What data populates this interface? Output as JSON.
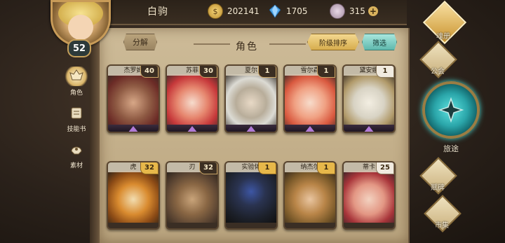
{
  "topbar": {
    "player_name": "白驹",
    "gold": "202141",
    "crystals": "1705",
    "stones": "315",
    "plus": "+"
  },
  "player": {
    "level": "52"
  },
  "left_tabs": [
    {
      "label": "角色",
      "icon": "hero-icon"
    },
    {
      "label": "技能书",
      "icon": "skillbook-icon"
    },
    {
      "label": "素材",
      "icon": "material-icon"
    }
  ],
  "header": {
    "split_label": "分解",
    "title": "角色",
    "sort_label": "阶级排序",
    "filter_label": "筛选"
  },
  "heroes": [
    {
      "name": "杰罗姆",
      "count": "40",
      "badge": "dark"
    },
    {
      "name": "苏菲",
      "count": "30",
      "badge": "dark"
    },
    {
      "name": "夏尔",
      "count": "1",
      "badge": "dark"
    },
    {
      "name": "雪尔森",
      "count": "1",
      "badge": "dark"
    },
    {
      "name": "黛安娜",
      "count": "1",
      "badge": "white"
    },
    {
      "name": "虎",
      "count": "32",
      "badge": "gold"
    },
    {
      "name": "刃",
      "count": "32",
      "badge": "dark"
    },
    {
      "name": "实验体",
      "count": "1",
      "badge": "gold"
    },
    {
      "name": "纳杰尔",
      "count": "1",
      "badge": "gold"
    },
    {
      "name": "蒂卡",
      "count": "25",
      "badge": "white"
    }
  ],
  "right_nav": {
    "soul": "魂册",
    "guild": "公会",
    "journey": "旅途",
    "runes": "赋碑",
    "market": "市集"
  }
}
